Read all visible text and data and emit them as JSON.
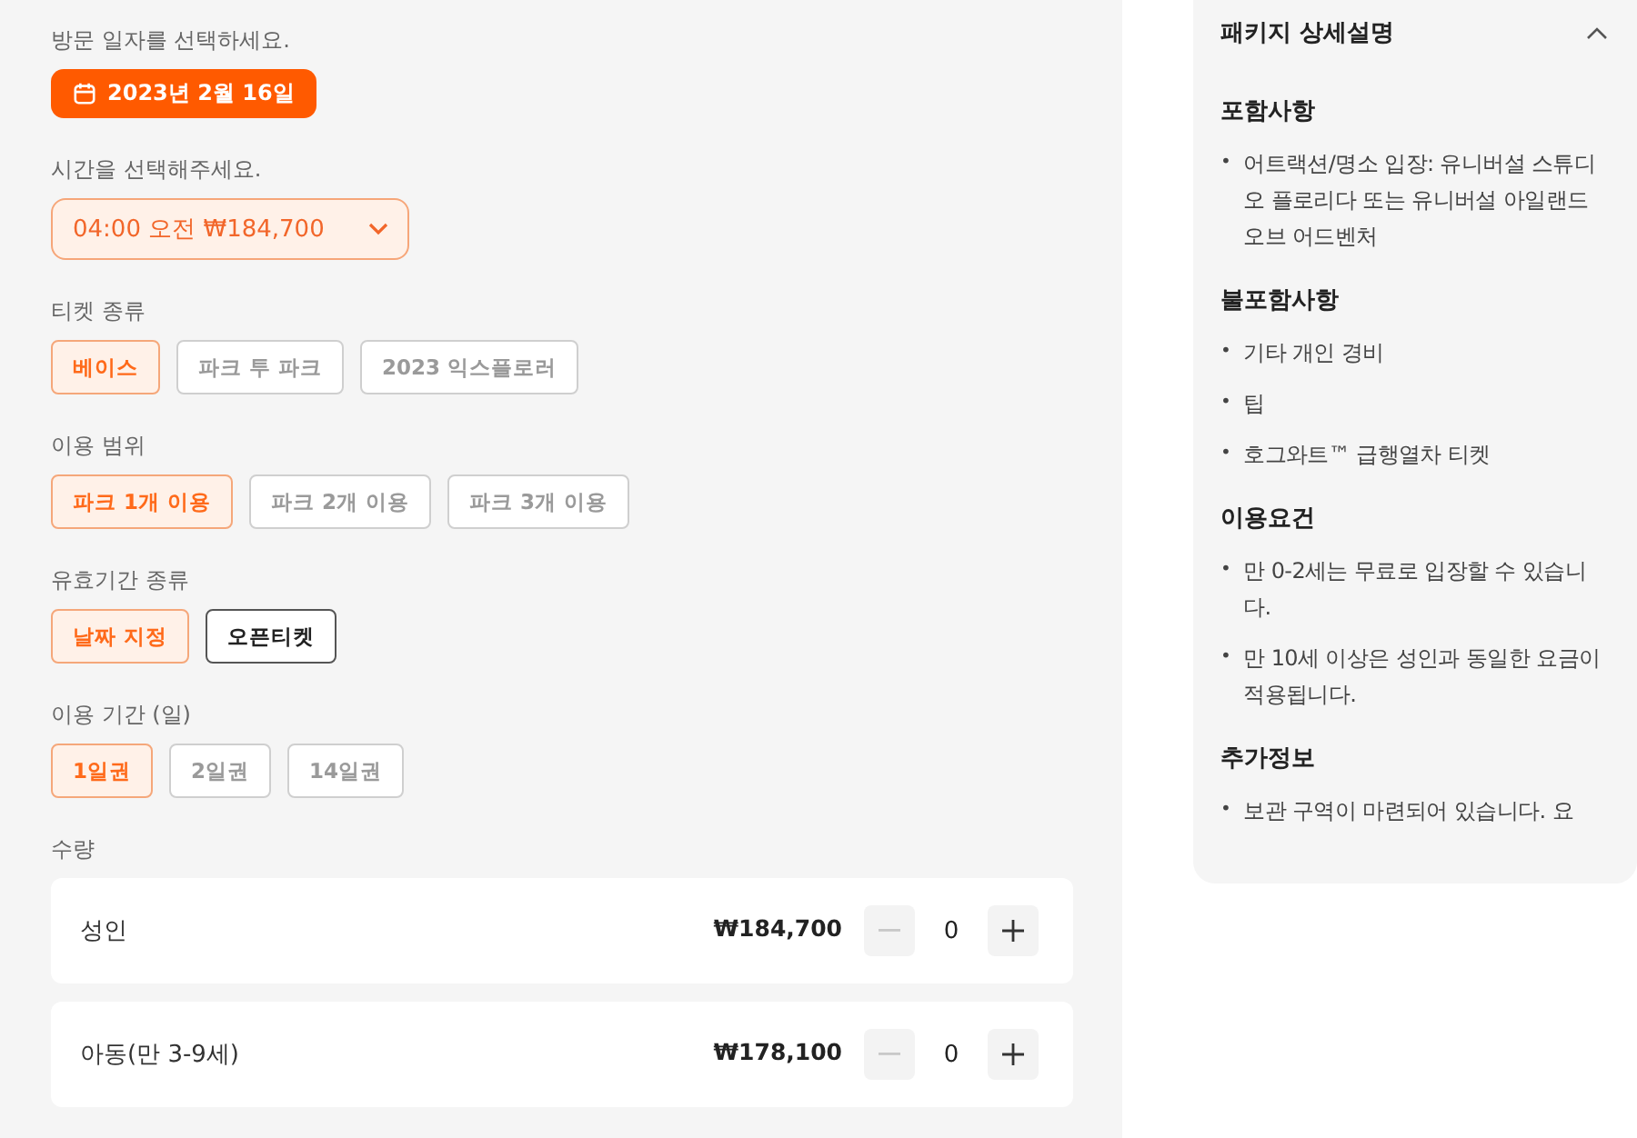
{
  "date_section": {
    "label": "방문 일자를 선택하세요.",
    "date": "2023년 2월 16일"
  },
  "time_section": {
    "label": "시간을 선택해주세요.",
    "value": "04:00 오전 ₩184,700"
  },
  "option_groups": [
    {
      "label": "티켓 종류",
      "options": [
        {
          "label": "베이스",
          "selected": true,
          "hovered": false
        },
        {
          "label": "파크 투 파크",
          "selected": false,
          "hovered": false
        },
        {
          "label": "2023 익스플로러",
          "selected": false,
          "hovered": false
        }
      ]
    },
    {
      "label": "이용 범위",
      "options": [
        {
          "label": "파크 1개 이용",
          "selected": true,
          "hovered": false
        },
        {
          "label": "파크 2개 이용",
          "selected": false,
          "hovered": false
        },
        {
          "label": "파크 3개 이용",
          "selected": false,
          "hovered": false
        }
      ]
    },
    {
      "label": "유효기간 종류",
      "options": [
        {
          "label": "날짜 지정",
          "selected": true,
          "hovered": false
        },
        {
          "label": "오픈티켓",
          "selected": false,
          "hovered": true
        }
      ]
    },
    {
      "label": "이용 기간 (일)",
      "options": [
        {
          "label": "1일권",
          "selected": true,
          "hovered": false
        },
        {
          "label": "2일권",
          "selected": false,
          "hovered": false
        },
        {
          "label": "14일권",
          "selected": false,
          "hovered": false
        }
      ]
    }
  ],
  "quantity": {
    "label": "수량",
    "rows": [
      {
        "name": "성인",
        "price": "₩184,700",
        "count": "0",
        "decrease_disabled": true
      },
      {
        "name": "아동(만 3-9세)",
        "price": "₩178,100",
        "count": "0",
        "decrease_disabled": true
      }
    ]
  },
  "details": {
    "title": "패키지 상세설명",
    "expanded": true,
    "bullet": "•",
    "sections": [
      {
        "heading": "포함사항",
        "items": [
          "어트랙션/명소 입장: 유니버설 스튜디오 플로리다 또는 유니버설 아일랜드 오브 어드벤처"
        ]
      },
      {
        "heading": "불포함사항",
        "items": [
          "기타 개인 경비",
          "팁",
          "호그와트™ 급행열차 티켓"
        ]
      },
      {
        "heading": "이용요건",
        "items": [
          "만 0-2세는 무료로 입장할 수 있습니다.",
          "만 10세 이상은 성인과 동일한 요금이 적용됩니다."
        ]
      },
      {
        "heading": "추가정보",
        "items": [
          "보관 구역이 마련되어 있습니다. 요"
        ]
      }
    ]
  }
}
